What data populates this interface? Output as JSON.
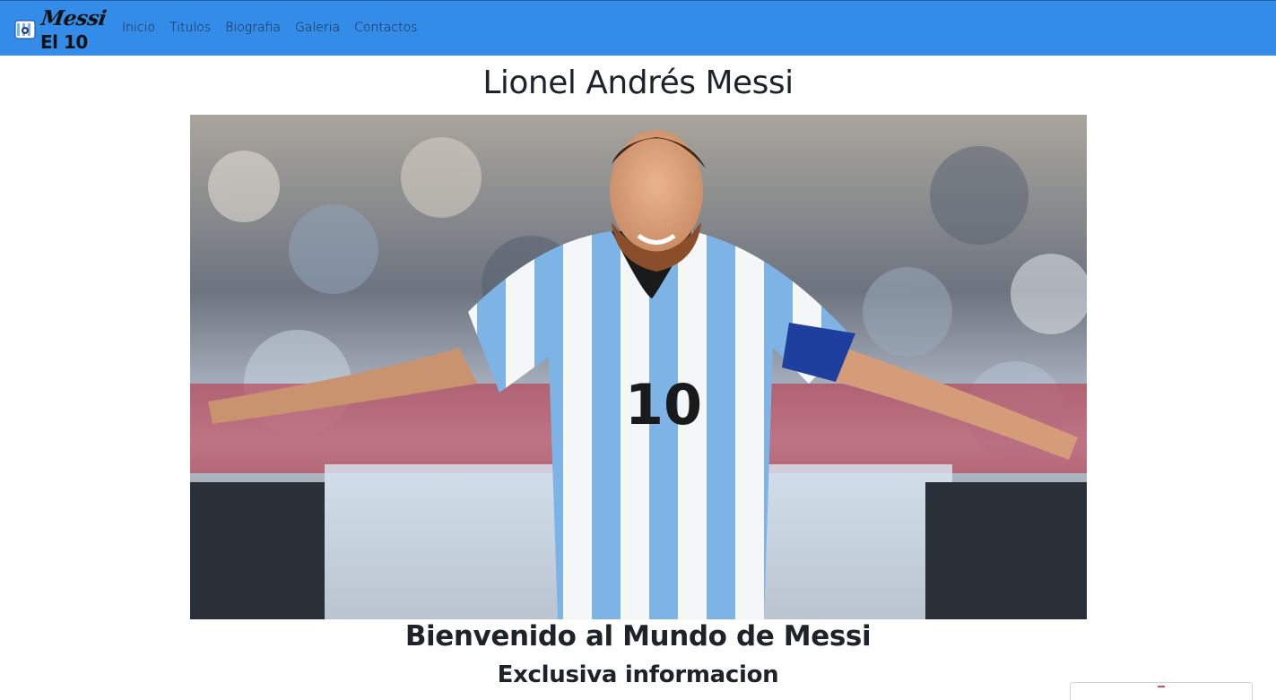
{
  "navbar": {
    "brand_script": "Messi",
    "brand_number": "El 10",
    "links": [
      "Inicio",
      "Titulos",
      "Biografia",
      "Galeria",
      "Contactos"
    ],
    "background": "#348ce9"
  },
  "main": {
    "title": "Lionel Andrés Messi",
    "hero_number": "10",
    "welcome": "Bienvenido al Mundo de Messi",
    "subtitle": "Exclusiva informacion"
  }
}
